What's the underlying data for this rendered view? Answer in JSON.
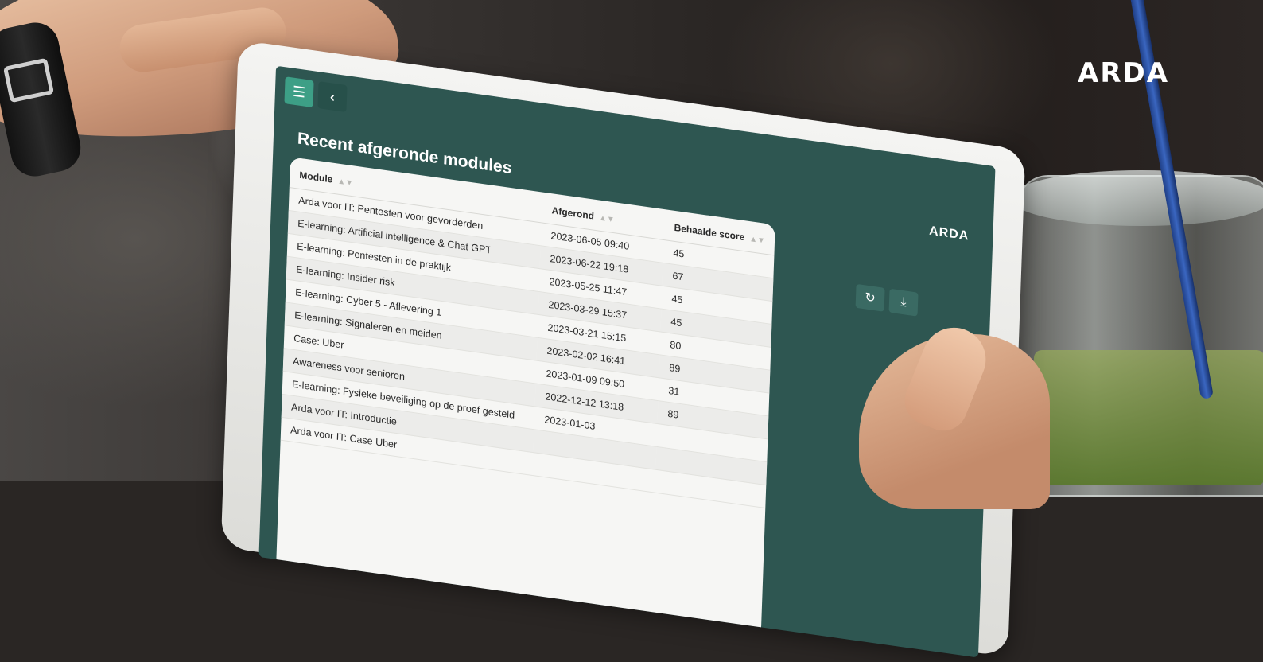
{
  "brand": {
    "logo_text": "ARDA"
  },
  "screen": {
    "page_title": "Recent afgeronde modules",
    "logo_text": "ARDA",
    "menu_icon": "hamburger-menu-icon",
    "back_icon": "chevron-left-icon",
    "refresh_icon": "refresh-icon",
    "download_icon": "download-icon",
    "accent_color": "#3d9f86",
    "panel_color": "#2e5651"
  },
  "table": {
    "headers": [
      "Module",
      "Afgerond",
      "Behaalde score"
    ],
    "rows": [
      {
        "module": "Arda voor IT: Pentesten voor gevorderden",
        "date": "2023-06-05 09:40",
        "score": "45"
      },
      {
        "module": "E-learning: Artificial intelligence & Chat GPT",
        "date": "2023-06-22 19:18",
        "score": "67"
      },
      {
        "module": "E-learning: Pentesten in de praktijk",
        "date": "2023-05-25 11:47",
        "score": "45"
      },
      {
        "module": "E-learning: Insider risk",
        "date": "2023-03-29 15:37",
        "score": "45"
      },
      {
        "module": "E-learning: Cyber 5 - Aflevering 1",
        "date": "2023-03-21 15:15",
        "score": "80"
      },
      {
        "module": "E-learning: Signaleren en meiden",
        "date": "2023-02-02 16:41",
        "score": "89"
      },
      {
        "module": "Case: Uber",
        "date": "2023-01-09 09:50",
        "score": "31"
      },
      {
        "module": "Awareness voor senioren",
        "date": "2022-12-12 13:18",
        "score": "89"
      },
      {
        "module": "E-learning: Fysieke beveiliging op de proef gesteld",
        "date": "2023-01-03",
        "score": ""
      },
      {
        "module": "Arda voor IT: Introductie",
        "date": "",
        "score": ""
      },
      {
        "module": "Arda voor IT: Case Uber",
        "date": "",
        "score": ""
      }
    ]
  }
}
